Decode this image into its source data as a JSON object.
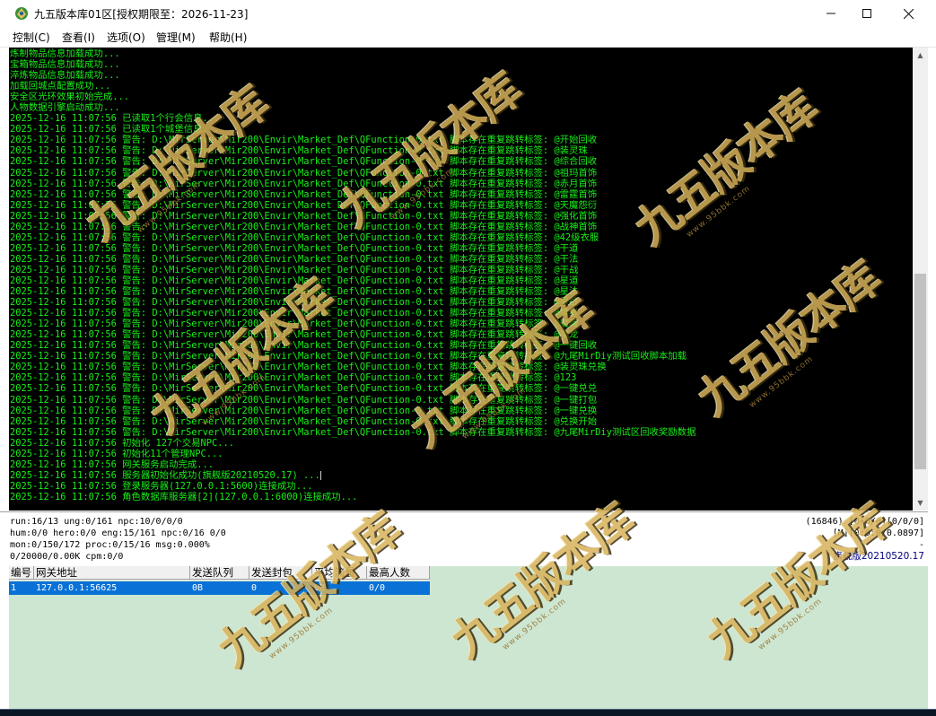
{
  "window": {
    "title": "九五版本库01区[授权期限至：2026-11-23]"
  },
  "menu": [
    "控制(C)",
    "查看(I)",
    "选项(O)",
    "管理(M)",
    "帮助(H)"
  ],
  "console": {
    "lines": [
      "炼制物品信息加载成功...",
      "宝箱物品信息加载成功...",
      "淬炼物品信息加载成功...",
      "加载回城点配置成功...",
      "安全区光环效果初始完成...",
      "人物数据引擎启动成功...",
      "2025-12-16 11:07:56 已读取1个行会信息...",
      "2025-12-16 11:07:56 已读取1个城堡信息...",
      "2025-12-16 11:07:56 警告: D:\\MirServer\\Mir200\\Envir\\Market_Def\\QFunction-0.txt 脚本存在重复跳转标签: @开始回收",
      "2025-12-16 11:07:56 警告: D:\\MirServer\\Mir200\\Envir\\Market_Def\\QFunction-0.txt 脚本存在重复跳转标签: @装灵珠",
      "2025-12-16 11:07:56 警告: D:\\MirServer\\Mir200\\Envir\\Market_Def\\QFunction-0.txt 脚本存在重复跳转标签: @综合回收",
      "2025-12-16 11:07:56 警告: D:\\MirServer\\Mir200\\Envir\\Market_Def\\QFunction-0.txt 脚本存在重复跳转标签: @祖玛首饰",
      "2025-12-16 11:07:56 警告: D:\\MirServer\\Mir200\\Envir\\Market_Def\\QFunction-0.txt 脚本存在重复跳转标签: @赤月首饰",
      "2025-12-16 11:07:56 警告: D:\\MirServer\\Mir200\\Envir\\Market_Def\\QFunction-0.txt 脚本存在重复跳转标签: @雷霆首饰",
      "2025-12-16 11:07:56 警告: D:\\MirServer\\Mir200\\Envir\\Market_Def\\QFunction-0.txt 脚本存在重复跳转标签: @天魔怨衍",
      "2025-12-16 11:07:56 警告: D:\\MirServer\\Mir200\\Envir\\Market_Def\\QFunction-0.txt 脚本存在重复跳转标签: @强化首饰",
      "2025-12-16 11:07:56 警告: D:\\MirServer\\Mir200\\Envir\\Market_Def\\QFunction-0.txt 脚本存在重复跳转标签: @战神首饰",
      "2025-12-16 11:07:56 警告: D:\\MirServer\\Mir200\\Envir\\Market_Def\\QFunction-0.txt 脚本存在重复跳转标签: @42级衣服",
      "2025-12-16 11:07:56 警告: D:\\MirServer\\Mir200\\Envir\\Market_Def\\QFunction-0.txt 脚本存在重复跳转标签: @干道",
      "2025-12-16 11:07:56 警告: D:\\MirServer\\Mir200\\Envir\\Market_Def\\QFunction-0.txt 脚本存在重复跳转标签: @干法",
      "2025-12-16 11:07:56 警告: D:\\MirServer\\Mir200\\Envir\\Market_Def\\QFunction-0.txt 脚本存在重复跳转标签: @干战",
      "2025-12-16 11:07:56 警告: D:\\MirServer\\Mir200\\Envir\\Market_Def\\QFunction-0.txt 脚本存在重复跳转标签: @星道",
      "2025-12-16 11:07:56 警告: D:\\MirServer\\Mir200\\Envir\\Market_Def\\QFunction-0.txt 脚本存在重复跳转标签: @星法",
      "2025-12-16 11:07:56 警告: D:\\MirServer\\Mir200\\Envir\\Market_Def\\QFunction-0.txt 脚本存在重复跳转标签: @星战",
      "2025-12-16 11:07:56 警告: D:\\MirServer\\Mir200\\Envir\\Market_Def\\QFunction-0.txt 脚本存在重复跳转标签: @猜者",
      "2025-12-16 11:07:56 警告: D:\\MirServer\\Mir200\\Envir\\Market_Def\\QFunction-0.txt 脚本存在重复跳转标签: @魔魂",
      "2025-12-16 11:07:56 警告: D:\\MirServer\\Mir200\\Envir\\Market_Def\\QFunction-0.txt 脚本存在重复跳转标签: @魔龙",
      "2025-12-16 11:07:56 警告: D:\\MirServer\\Mir200\\Envir\\Market_Def\\QFunction-0.txt 脚本存在重复跳转标签: @一键回收",
      "2025-12-16 11:07:56 警告: D:\\MirServer\\Mir200\\Envir\\Market_Def\\QFunction-0.txt 脚本存在重复跳转标签: @九尾MirDiy测试回收脚本加载",
      "2025-12-16 11:07:56 警告: D:\\MirServer\\Mir200\\Envir\\Market_Def\\QFunction-0.txt 脚本存在重复跳转标签: @装灵珠兑换",
      "2025-12-16 11:07:56 警告: D:\\MirServer\\Mir200\\Envir\\Market_Def\\QFunction-0.txt 脚本存在重复跳转标签: @123",
      "2025-12-16 11:07:56 警告: D:\\MirServer\\Mir200\\Envir\\Market_Def\\QFunction-0.txt 脚本存在重复跳转标签: @一键兑兑",
      "2025-12-16 11:07:56 警告: D:\\MirServer\\Mir200\\Envir\\Market_Def\\QFunction-0.txt 脚本存在重复跳转标签: @一键打包",
      "2025-12-16 11:07:56 警告: D:\\MirServer\\Mir200\\Envir\\Market_Def\\QFunction-0.txt 脚本存在重复跳转标签: @一键兑换",
      "2025-12-16 11:07:56 警告: D:\\MirServer\\Mir200\\Envir\\Market_Def\\QFunction-0.txt 脚本存在重复跳转标签: @兑换开始",
      "2025-12-16 11:07:56 警告: D:\\MirServer\\Mir200\\Envir\\Market_Def\\QFunction-0.txt 脚本存在重复跳转标签: @九尾MirDiy测试区回收奖励数据",
      "2025-12-16 11:07:56 初始化 127个交易NPC...",
      "2025-12-16 11:07:56 初始化11个管理NPC...",
      "2025-12-16 11:07:56 网关服务启动完成...",
      "2025-12-16 11:07:56 服务器初始化成功(旗舰版20210520.17) ...",
      "2025-12-16 11:07:56 登录服务器(127.0.0.1:5600)连接成功...",
      "2025-12-16 11:07:56 角色数据库服务器[2](127.0.0.1:6000)连接成功..."
    ]
  },
  "status": {
    "left": [
      "run:16/13 ung:0/161 npc:10/0/0/0",
      "hum:0/0 hero:0/0 eng:15/161 npc:0/16 0/0",
      "mon:0/150/172 proc:0/15/16 msg:0.000%",
      "0/20000/0.00K cpm:0/0"
    ],
    "right": [
      "(16846) [0+0/0][0/0/0]",
      "[M][0:0:0/0.0897]",
      "-",
      "旗舰版20210520.17"
    ]
  },
  "gateway": {
    "columns": [
      "编号",
      "网关地址",
      "发送队列",
      "发送封包",
      "平均流量",
      "最高人数"
    ],
    "rows": [
      [
        "1",
        "127.0.0.1:56625",
        "0B",
        "0",
        "0B",
        "0/0"
      ]
    ]
  },
  "watermark": {
    "text": "九五版本库",
    "url": "www.95bbk.com"
  },
  "colors": {
    "console_bg": "#000000",
    "console_text": "#18ef18",
    "gateway_bg": "#cde6d2",
    "selected_row": "#0a72d6"
  }
}
